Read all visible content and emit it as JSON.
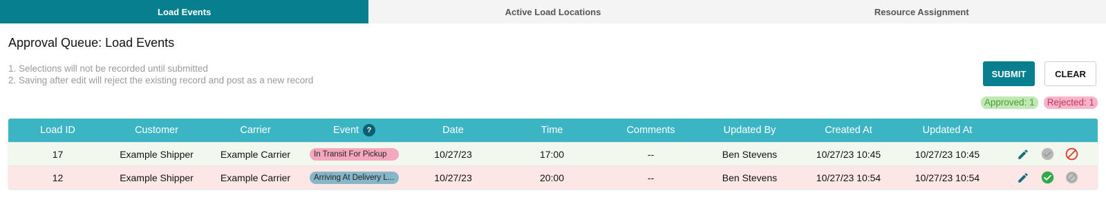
{
  "tabs": [
    {
      "label": "Load Events",
      "active": true
    },
    {
      "label": "Active Load Locations",
      "active": false
    },
    {
      "label": "Resource Assignment",
      "active": false
    }
  ],
  "page": {
    "title": "Approval Queue: Load Events",
    "notes": [
      "1. Selections will not be recorded until submitted",
      "2. Saving after edit will reject the existing record and post as a new record"
    ]
  },
  "actions": {
    "submit_label": "SUBMIT",
    "clear_label": "CLEAR"
  },
  "counts": {
    "approved": "Approved: 1",
    "rejected": "Rejected: 1"
  },
  "table": {
    "headers": [
      "Load ID",
      "Customer",
      "Carrier",
      "Event",
      "Date",
      "Time",
      "Comments",
      "Updated By",
      "Created At",
      "Updated At"
    ],
    "event_help_glyph": "?",
    "rows": [
      {
        "status": "rejected-selection",
        "load_id": "17",
        "customer": "Example Shipper",
        "carrier": "Example Carrier",
        "event": "In Transit For Pickup",
        "event_color": "#f5a7bf",
        "date": "10/27/23",
        "time": "17:00",
        "comments": "--",
        "updated_by": "Ben Stevens",
        "created_at": "10/27/23 10:45",
        "updated_at": "10/27/23 10:45",
        "icons": [
          "edit-icon",
          "approve-icon-inactive",
          "reject-icon-active"
        ]
      },
      {
        "status": "approved-selection",
        "load_id": "12",
        "customer": "Example Shipper",
        "carrier": "Example Carrier",
        "event": "Arriving At Delivery L...",
        "event_color": "#86b6c8",
        "date": "10/27/23",
        "time": "20:00",
        "comments": "--",
        "updated_by": "Ben Stevens",
        "created_at": "10/27/23 10:54",
        "updated_at": "10/27/23 10:54",
        "icons": [
          "edit-icon",
          "approve-icon-active",
          "reject-icon-inactive"
        ]
      }
    ]
  },
  "colors": {
    "accent": "#077f8e",
    "table_header": "#3bb4c4",
    "row_approved_bg": "#f2f8ee",
    "row_rejected_bg": "#fde6e6",
    "approve_active": "#2eaa4a",
    "reject_active": "#e0402f",
    "icon_inactive": "#b8b8b8"
  }
}
